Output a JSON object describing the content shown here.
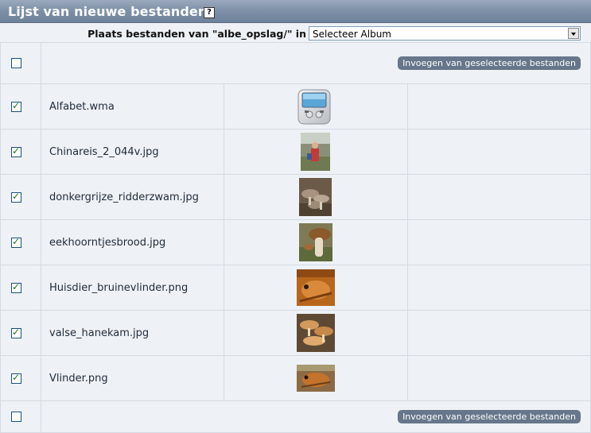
{
  "header": {
    "title": "Lijst van nieuwe bestanden",
    "help_icon": "?"
  },
  "album": {
    "label": "Plaats bestanden van \"albe_opslag/\" in",
    "selected": "Selecteer Album"
  },
  "actions": {
    "insert_label": "Invoegen van geselecteerde bestanden"
  },
  "files": [
    {
      "name": "Alfabet.wma",
      "checked": true,
      "thumb": "media-player-icon"
    },
    {
      "name": "Chinareis_2_044v.jpg",
      "checked": true,
      "thumb": "photo-thumbnail"
    },
    {
      "name": "donkergrijze_ridderzwam.jpg",
      "checked": true,
      "thumb": "photo-thumbnail"
    },
    {
      "name": "eekhoorntjesbrood.jpg",
      "checked": true,
      "thumb": "photo-thumbnail"
    },
    {
      "name": "Huisdier_bruinevlinder.png",
      "checked": true,
      "thumb": "photo-thumbnail"
    },
    {
      "name": "valse_hanekam.jpg",
      "checked": true,
      "thumb": "photo-thumbnail"
    },
    {
      "name": "Vlinder.png",
      "checked": true,
      "thumb": "photo-thumbnail"
    }
  ],
  "colors": {
    "title_bar": "#7d8fa6",
    "button": "#67768a",
    "row_bg": "#eef1f5"
  }
}
